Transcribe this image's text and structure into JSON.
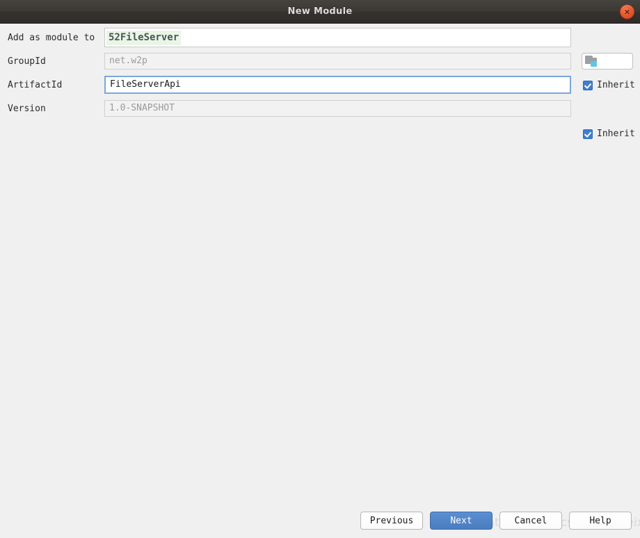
{
  "window": {
    "title": "New Module",
    "close_icon": "close-icon",
    "close_glyph": "×"
  },
  "form": {
    "rows": [
      {
        "label": "Add as module to",
        "value": "52FileServer"
      },
      {
        "label": "GroupId",
        "value": "net.w2p"
      },
      {
        "label": "ArtifactId",
        "value": "FileServerApi"
      },
      {
        "label": "Version",
        "value": "1.0-SNAPSHOT"
      }
    ],
    "browse": {
      "icon": "module-folder-icon",
      "tooltip": ""
    },
    "inherit": {
      "groupid_label": "Inherit",
      "version_label": "Inherit",
      "checked": true
    }
  },
  "footer": {
    "previous": "Previous",
    "next": "Next",
    "cancel": "Cancel",
    "help": "Help"
  },
  "watermark": {
    "text": "https://blog.csdn.net/weixin"
  },
  "colors": {
    "titlebar": "#3c3935",
    "close_button": "#e8542a",
    "primary_button": "#4a7cc0",
    "selection_highlight": "#e9f5e6",
    "focus_border": "#7aa7dd",
    "checkbox": "#3f7fd0",
    "window_background": "#f0f0f0"
  }
}
